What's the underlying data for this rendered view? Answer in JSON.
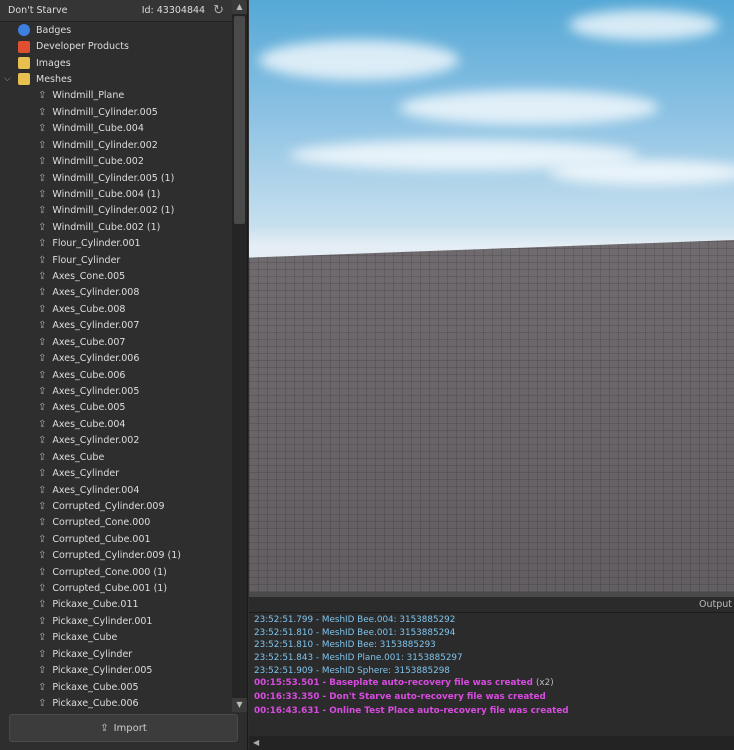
{
  "panel": {
    "title": "Don't Starve",
    "id_label": "Id: 43304844",
    "import_label": "Import"
  },
  "categories": [
    {
      "label": "Badges",
      "color": "#3d7fe0"
    },
    {
      "label": "Developer Products",
      "color": "#e05030"
    },
    {
      "label": "Images",
      "color": "#e8c050"
    },
    {
      "label": "Meshes",
      "color": "#e8c050"
    }
  ],
  "meshes": [
    "Windmill_Plane",
    "Windmill_Cylinder.005",
    "Windmill_Cube.004",
    "Windmill_Cylinder.002",
    "Windmill_Cube.002",
    "Windmill_Cylinder.005 (1)",
    "Windmill_Cube.004 (1)",
    "Windmill_Cylinder.002 (1)",
    "Windmill_Cube.002 (1)",
    "Flour_Cylinder.001",
    "Flour_Cylinder",
    "Axes_Cone.005",
    "Axes_Cylinder.008",
    "Axes_Cube.008",
    "Axes_Cylinder.007",
    "Axes_Cube.007",
    "Axes_Cylinder.006",
    "Axes_Cube.006",
    "Axes_Cylinder.005",
    "Axes_Cube.005",
    "Axes_Cube.004",
    "Axes_Cylinder.002",
    "Axes_Cube",
    "Axes_Cylinder",
    "Axes_Cylinder.004",
    "Corrupted_Cylinder.009",
    "Corrupted_Cone.000",
    "Corrupted_Cube.001",
    "Corrupted_Cylinder.009 (1)",
    "Corrupted_Cone.000 (1)",
    "Corrupted_Cube.001 (1)",
    "Pickaxe_Cube.011",
    "Pickaxe_Cylinder.001",
    "Pickaxe_Cube",
    "Pickaxe_Cylinder",
    "Pickaxe_Cylinder.005",
    "Pickaxe_Cube.005",
    "Pickaxe_Cube.006"
  ],
  "output": {
    "title": "Output",
    "lines": [
      {
        "text": "23:52:51.799 - MeshID Bee.004: 3153885292",
        "type": "info"
      },
      {
        "text": "23:52:51.810 - MeshID Bee.001: 3153885294",
        "type": "info"
      },
      {
        "text": "23:52:51.810 - MeshID Bee: 3153885293",
        "type": "info"
      },
      {
        "text": "23:52:51.843 - MeshID Plane.001: 3153885297",
        "type": "info"
      },
      {
        "text": "23:52:51.909 - MeshID Sphere: 3153885298",
        "type": "info"
      },
      {
        "text": "00:15:53.501 - Baseplate auto-recovery file was created",
        "type": "warn",
        "count": "(x2)"
      },
      {
        "text": "00:16:33.350 - Don't Starve auto-recovery file was created",
        "type": "warn"
      },
      {
        "text": "00:16:43.631 - Online Test Place auto-recovery file was created",
        "type": "warn"
      }
    ]
  }
}
